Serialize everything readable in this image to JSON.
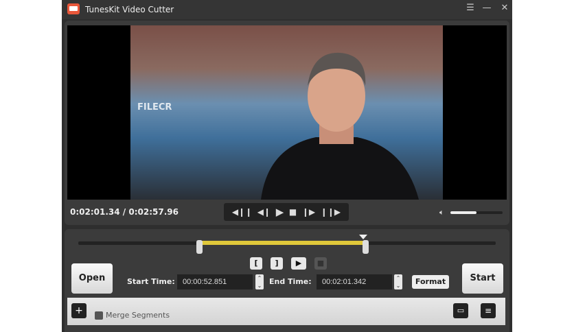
{
  "app": {
    "title": "TunesKit Video Cutter"
  },
  "window_buttons": {
    "menu": "☰",
    "minimize": "—",
    "close": "✕"
  },
  "video": {
    "watermark": "FILECR"
  },
  "player": {
    "time": "0:02:01.34 / 0:02:57.96",
    "volume_percent": 50
  },
  "controls": {
    "prev_segment": "◀❙❙",
    "prev_frame": "◀❙",
    "play": "▶",
    "stop": "■",
    "next_frame": "❙▶",
    "next_segment": "❙❙▶"
  },
  "timeline": {
    "selection_start_percent": 29.4,
    "selection_end_percent": 68.3,
    "playhead_percent": 68.3
  },
  "segment_buttons": {
    "mark_in": "[",
    "mark_out": "]",
    "preview": "▶",
    "stop": "■"
  },
  "buttons": {
    "open": "Open",
    "start": "Start",
    "format": "Format"
  },
  "fields": {
    "start_label": "Start Time:",
    "start_value": "00:00:52.851",
    "end_label": "End Time:",
    "end_value": "00:02:01.342"
  },
  "bottom": {
    "add": "+",
    "merge_label": "Merge Segments"
  }
}
